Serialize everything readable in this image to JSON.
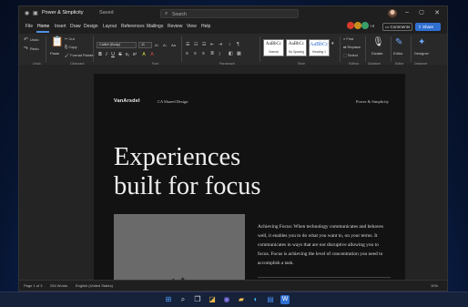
{
  "window": {
    "doc_title": "Power & Simplicity",
    "saved_status": "Saved",
    "search_placeholder": "Search"
  },
  "menu": [
    "File",
    "Home",
    "Insert",
    "Draw",
    "Design",
    "Layout",
    "References",
    "Mailings",
    "Review",
    "View",
    "Help"
  ],
  "active_menu": "Home",
  "collaborators": {
    "more_count": "+4",
    "colors": [
      "#d83b2b",
      "#c98f1e",
      "#3aa06a"
    ]
  },
  "actions": {
    "comments": "Comments",
    "share": "Share"
  },
  "ribbon": {
    "undo_label": "Undo",
    "redo_label": "Redo",
    "paste_label": "Paste",
    "cut_label": "Cut",
    "copy_label": "Copy",
    "format_painter_label": "Format Painter",
    "font_name": "Calibri (Body)",
    "font_size": "11",
    "format_buttons": [
      "B",
      "I",
      "U",
      "S",
      "x₂",
      "x²",
      "A",
      "A"
    ],
    "styles": [
      {
        "preview": "AaBbCc",
        "name": "Normal"
      },
      {
        "preview": "AaBbCc",
        "name": "No Spacing"
      },
      {
        "preview": "AaBbCc",
        "name": "Heading 1"
      }
    ],
    "find_label": "Find",
    "replace_label": "Replace",
    "select_label": "Select",
    "dictate_label": "Dictate",
    "editor_label": "Editor",
    "designer_label": "Designer",
    "groups": [
      "Undo",
      "Clipboard",
      "Font",
      "Paragraph",
      "Style",
      "Editing",
      "Dictation",
      "Editor",
      "Designer"
    ]
  },
  "document": {
    "logo": "VanArsdel",
    "header_center": "CA Shared Design",
    "header_right": "Power & Simplicity",
    "headline_line1": "Experiences",
    "headline_line2": "built for focus",
    "body": "Achieving Focus: When technology communicates and behaves well, it enables you to do what you want to, on your terms. It communicates in ways that are not disruptive allowing you to focus. Focus is achieving the level of concentration you need to accomplish a task."
  },
  "status": {
    "page": "Page 1 of 3",
    "words": "254 Words",
    "language": "English (United States)",
    "zoom": "10%"
  },
  "colors": {
    "accent": "#2f6fd1",
    "ribbon": "#292929",
    "page": "#121212"
  }
}
